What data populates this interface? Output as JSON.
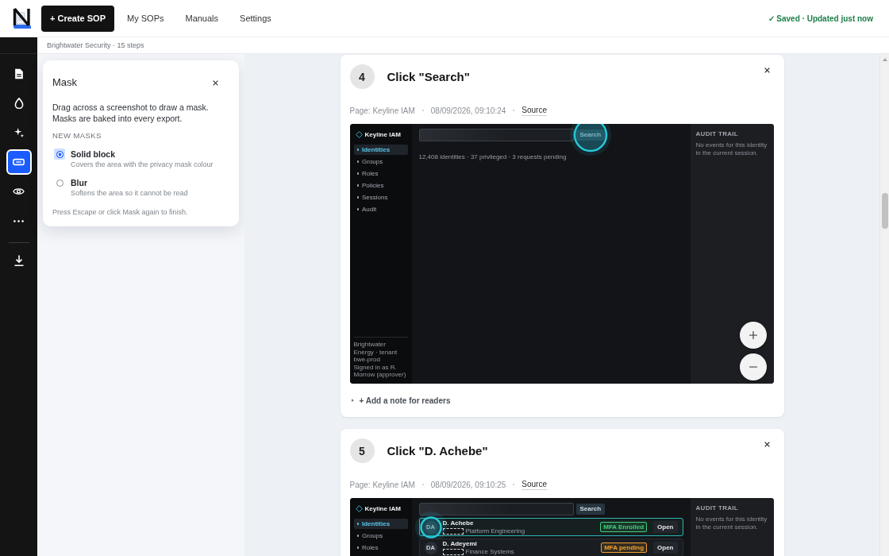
{
  "topbar": {
    "create_button": "+ Create SOP",
    "nav": [
      {
        "label": "My SOPs",
        "selected": false
      },
      {
        "label": "Manuals",
        "selected": false
      },
      {
        "label": "Settings",
        "selected": false
      }
    ],
    "save_status": "✓ Saved · Updated just now"
  },
  "breadcrumb": "Brightwater Security · 15 steps",
  "sidebar": {
    "tools": [
      {
        "kind": "document",
        "selected": false
      },
      {
        "kind": "drop",
        "selected": false
      },
      {
        "kind": "sparkle",
        "selected": false
      },
      {
        "kind": "mask",
        "selected": true
      },
      {
        "kind": "eye",
        "selected": false
      },
      {
        "kind": "more",
        "selected": false
      }
    ],
    "actions": [
      {
        "kind": "download",
        "selected": false
      }
    ]
  },
  "mask_panel": {
    "title": "Mask",
    "description": "Drag across a screenshot to draw a mask. Masks are baked into every export.",
    "section_label": "NEW MASKS",
    "options": [
      {
        "label": "Solid block",
        "description": "Covers the area with the privacy mask colour",
        "selected": true
      },
      {
        "label": "Blur",
        "description": "Softens the area so it cannot be read",
        "selected": false
      }
    ],
    "hint": "Press Escape or click Mask again to finish."
  },
  "steps": [
    {
      "number": "4",
      "title": "Click \"Search\"",
      "page": "Page: Keyline IAM",
      "time": "08/09/2026, 09:10:24",
      "source": "Source",
      "screenshot": {
        "app_name": "Keyline IAM",
        "nav": [
          {
            "label": "Identities",
            "selected": true
          },
          {
            "label": "Groups",
            "selected": false
          },
          {
            "label": "Roles",
            "selected": false
          },
          {
            "label": "Policies",
            "selected": false
          },
          {
            "label": "Sessions",
            "selected": false
          },
          {
            "label": "Audit",
            "selected": false
          }
        ],
        "footer": [
          "Brightwater Energy · tenant bwe-prod",
          "Signed in as R. Morrow (approver)"
        ],
        "search_button": {
          "label": "Search",
          "clicked": true
        },
        "summary": "12,408 identities · 37 privileged · 3 requests pending",
        "side_panel": {
          "title": "AUDIT TRAIL",
          "text": "No events for this identity in the current session."
        }
      },
      "zoom_controls": true,
      "note": "+ Add a note for readers"
    },
    {
      "number": "5",
      "title": "Click \"D. Achebe\"",
      "page": "Page: Keyline IAM",
      "time": "08/09/2026, 09:10:25",
      "source": "Source",
      "screenshot": {
        "app_name": "Keyline IAM",
        "nav": [
          {
            "label": "Identities",
            "selected": true
          },
          {
            "label": "Groups",
            "selected": false
          },
          {
            "label": "Roles",
            "selected": false
          }
        ],
        "search_button": {
          "label": "Search",
          "clicked": false
        },
        "rows": [
          {
            "initials": "DA",
            "name": "D. Achebe",
            "masked": true,
            "team": "Platform Engineering",
            "badge": {
              "label": "MFA Enrolled",
              "color": "#3fd07a"
            },
            "action": "Open",
            "selected": true
          },
          {
            "initials": "DA",
            "name": "D. Adeyemi",
            "masked": true,
            "team": "Finance Systems",
            "badge": {
              "label": "MFA pending",
              "color": "#f0a030"
            },
            "action": "Open",
            "selected": false
          }
        ],
        "side_panel": {
          "title": "AUDIT TRAIL",
          "text": "No events for this identity in the current session."
        }
      },
      "zoom_controls": false
    }
  ]
}
